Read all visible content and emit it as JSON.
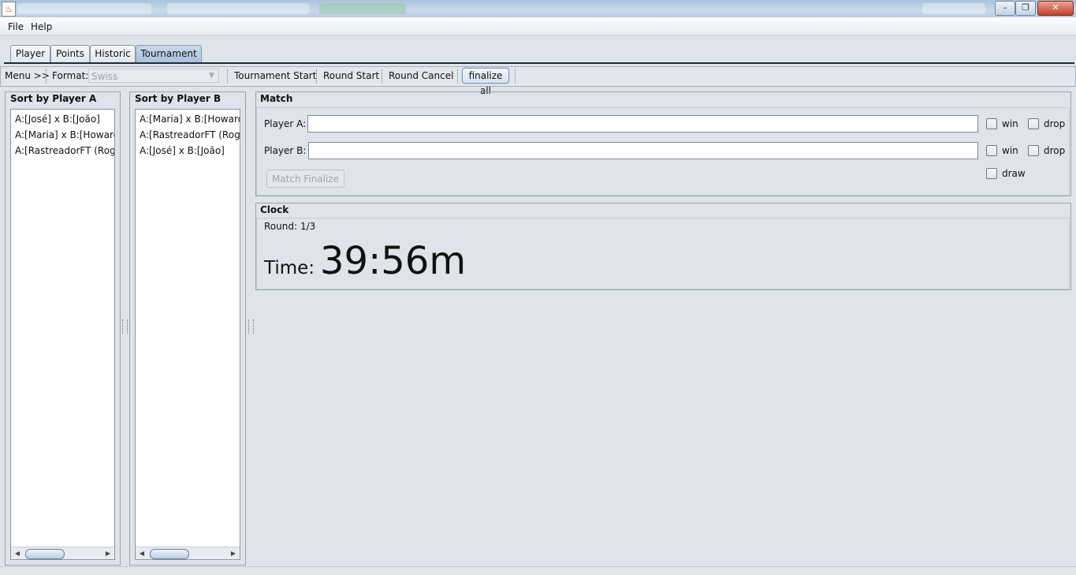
{
  "menubar": {
    "file": "File",
    "help": "Help"
  },
  "window": {
    "minimize_icon": "minimize-icon",
    "maximize_icon": "restore-icon",
    "close_icon": "close-icon"
  },
  "tabs": [
    {
      "label": "Player"
    },
    {
      "label": "Points"
    },
    {
      "label": "Historic"
    },
    {
      "label": "Tournament",
      "active": true
    }
  ],
  "toolbar": {
    "menu_label": "Menu >>",
    "format_label": "Format:",
    "format_value": "Swiss",
    "tournament_start": "Tournament Start",
    "round_start": "Round Start",
    "round_cancel": "Round Cancel",
    "finalize_all": "finalize all"
  },
  "sort_a": {
    "title": "Sort by Player A",
    "items": [
      "A:[José] x B:[João]",
      "A:[Maria] x B:[HowardHi",
      "A:[RastreadorFT (Rogé"
    ]
  },
  "sort_b": {
    "title": "Sort by Player B",
    "items": [
      "A:[Maria] x B:[HowardHi",
      "A:[RastreadorFT (Rogé",
      "A:[José] x B:[João]"
    ]
  },
  "match": {
    "title": "Match",
    "player_a_label": "Player A:",
    "player_b_label": "Player B:",
    "player_a_value": "",
    "player_b_value": "",
    "win_label": "win",
    "drop_label": "drop",
    "draw_label": "draw",
    "finalize_button": "Match Finalize"
  },
  "clock": {
    "title": "Clock",
    "round_label": "Round:",
    "round_value": "1/3",
    "time_label": "Time:",
    "time_value": "39:56m"
  }
}
